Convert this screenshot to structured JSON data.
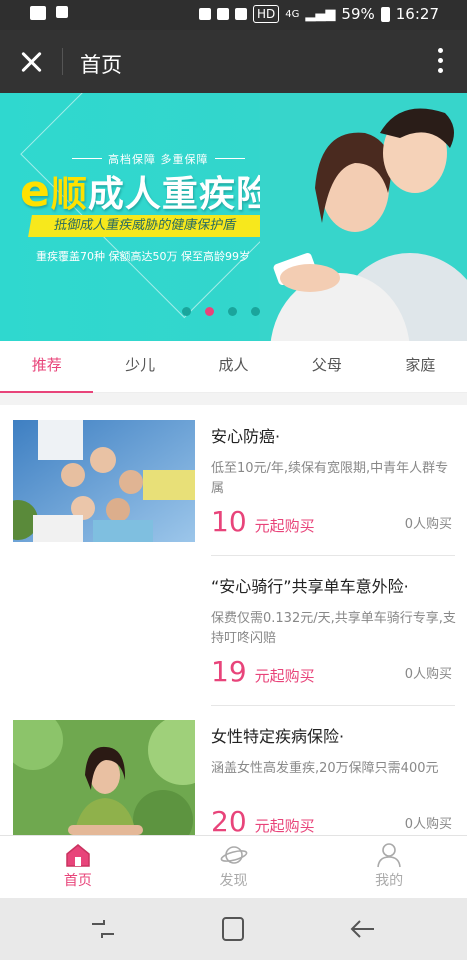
{
  "status_bar": {
    "battery_percent": "59%",
    "time": "16:27",
    "hd_label": "HD",
    "network": "4G"
  },
  "titlebar": {
    "title": "首页"
  },
  "banner": {
    "tagline": "高档保障  多重保障",
    "title_e": "e",
    "title_shun": "顺",
    "title_rest": "成人重疾险",
    "slogan": "抵御成人重疾威胁的健康保护盾",
    "features": "重疾覆盖70种   保额高达50万   保至高龄99岁",
    "slides": 4,
    "active_slide": 1
  },
  "tabs": [
    {
      "label": "推荐",
      "active": true
    },
    {
      "label": "少儿",
      "active": false
    },
    {
      "label": "成人",
      "active": false
    },
    {
      "label": "父母",
      "active": false
    },
    {
      "label": "家庭",
      "active": false
    }
  ],
  "products": [
    {
      "name": "安心防癌·",
      "desc": "低至10元/年,续保有宽限期,中青年人群专属",
      "price": "10",
      "price_suffix": "元起购买",
      "buyers": "0人购买",
      "image": "family-circle-photo"
    },
    {
      "name": "“安心骑行”共享单车意外险·",
      "desc": "保费仅需0.132元/天,共享单车骑行专享,支持叮咚闪赔",
      "price": "19",
      "price_suffix": "元起购买",
      "buyers": "0人购买",
      "image": ""
    },
    {
      "name": "女性特定疾病保险·",
      "desc": "涵盖女性高发重疾,20万保障只需400元",
      "price": "20",
      "price_suffix": "元起购买",
      "buyers": "0人购买",
      "image": "woman-portrait-photo"
    }
  ],
  "bottom_nav": [
    {
      "label": "首页",
      "icon": "home-icon",
      "active": true
    },
    {
      "label": "发现",
      "icon": "planet-icon",
      "active": false
    },
    {
      "label": "我的",
      "icon": "user-icon",
      "active": false
    }
  ],
  "colors": {
    "accent": "#e8447a",
    "banner_bg": "#33d6cc",
    "titlebar_bg": "#333333"
  }
}
